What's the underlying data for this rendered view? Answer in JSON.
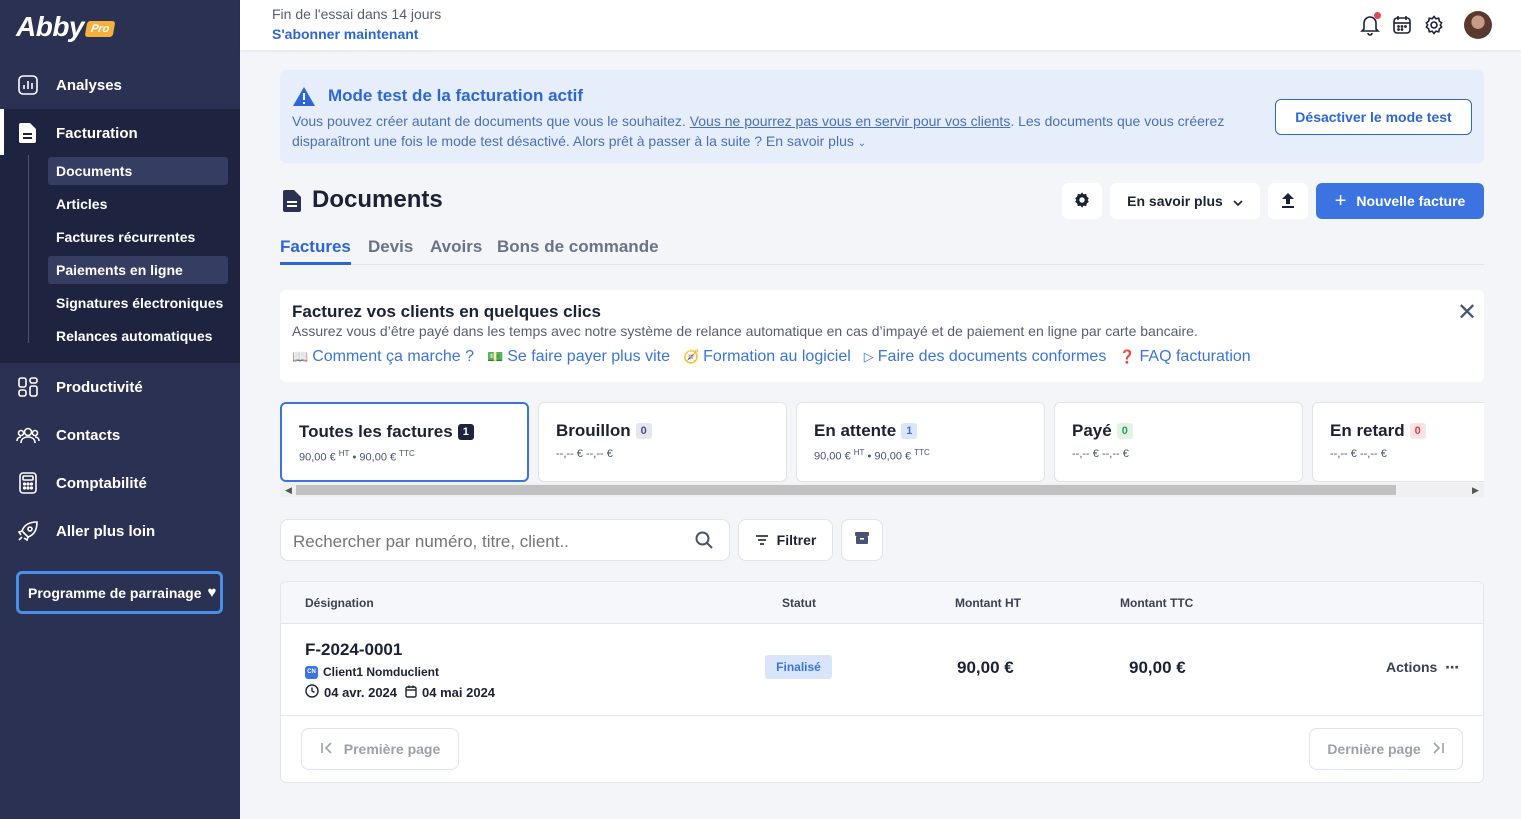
{
  "brand": {
    "logo": "Abby",
    "badge": "Pro"
  },
  "sidebar": {
    "items": [
      {
        "label": "Analyses",
        "icon": "chart-icon"
      },
      {
        "label": "Facturation",
        "icon": "invoice-icon"
      },
      {
        "label": "Productivité",
        "icon": "grid-icon"
      },
      {
        "label": "Contacts",
        "icon": "users-icon"
      },
      {
        "label": "Comptabilité",
        "icon": "calculator-icon"
      },
      {
        "label": "Aller plus loin",
        "icon": "rocket-icon"
      }
    ],
    "subitems": [
      "Documents",
      "Articles",
      "Factures récurrentes",
      "Paiements en ligne",
      "Signatures électroniques",
      "Relances automatiques"
    ],
    "referral": "Programme de parrainage"
  },
  "topbar": {
    "trial": "Fin de l'essai dans 14 jours",
    "subscribe": "S'abonner maintenant"
  },
  "banner": {
    "title": "Mode test de la facturation actif",
    "text_before": "Vous pouvez créer autant de documents que vous le souhaitez. ",
    "text_link": "Vous ne pourrez pas vous en servir pour vos clients",
    "text_after": ". Les documents que vous créerez disparaîtront une fois le mode test désactivé. Alors prêt à passer à la suite ? En savoir plus",
    "button": "Désactiver le mode test"
  },
  "page": {
    "title": "Documents",
    "learn_more": "En savoir plus",
    "new_invoice": "Nouvelle facture"
  },
  "tabs": [
    "Factures",
    "Devis",
    "Avoirs",
    "Bons de commande"
  ],
  "promo": {
    "title": "Facturez vos clients en quelques clics",
    "subtitle": "Assurez vous d’être payé dans les temps avec notre système de relance automatique en cas d’impayé et de paiement en ligne par carte bancaire.",
    "links": [
      "Comment ça marche ?",
      "Se faire payer plus vite",
      "Formation au logiciel",
      "Faire des documents conformes",
      "FAQ facturation"
    ]
  },
  "status_cards": [
    {
      "title": "Toutes les factures",
      "count": "1",
      "ht": "90,00 €",
      "ttc": "90,00 €",
      "badge_bg": "#1e2440",
      "badge_fg": "#ffffff"
    },
    {
      "title": "Brouillon",
      "count": "0",
      "amount": "--,-- € --,-- €",
      "badge_bg": "#e4e7f0",
      "badge_fg": "#4a5275"
    },
    {
      "title": "En attente",
      "count": "1",
      "ht": "90,00 €",
      "ttc": "90,00 €",
      "badge_bg": "#dbe6fb",
      "badge_fg": "#3b74e0"
    },
    {
      "title": "Payé",
      "count": "0",
      "amount": "--,-- € --,-- €",
      "badge_bg": "#e0f3e6",
      "badge_fg": "#2f9e55"
    },
    {
      "title": "En retard",
      "count": "0",
      "amount": "--,-- € --,-- €",
      "badge_bg": "#fde3e3",
      "badge_fg": "#d9434a"
    }
  ],
  "amount_labels": {
    "ht": "HT",
    "ttc": "TTC",
    "sep": " • "
  },
  "search": {
    "placeholder": "Rechercher par numéro, titre, client.."
  },
  "filter": "Filtrer",
  "table": {
    "headers": [
      "Désignation",
      "Statut",
      "Montant HT",
      "Montant TTC"
    ],
    "rows": [
      {
        "number": "F-2024-0001",
        "client_initials": "CN",
        "client": "Client1 Nomduclient",
        "date_created": "04 avr. 2024",
        "date_due": "04 mai 2024",
        "status": "Finalisé",
        "ht": "90,00 €",
        "ttc": "90,00 €",
        "actions": "Actions"
      }
    ],
    "first_page": "Première page",
    "last_page": "Dernière page"
  },
  "colors": {
    "sidebar": "#2a3152",
    "accent": "#3b74e0",
    "banner_bg": "#e6eefc"
  }
}
